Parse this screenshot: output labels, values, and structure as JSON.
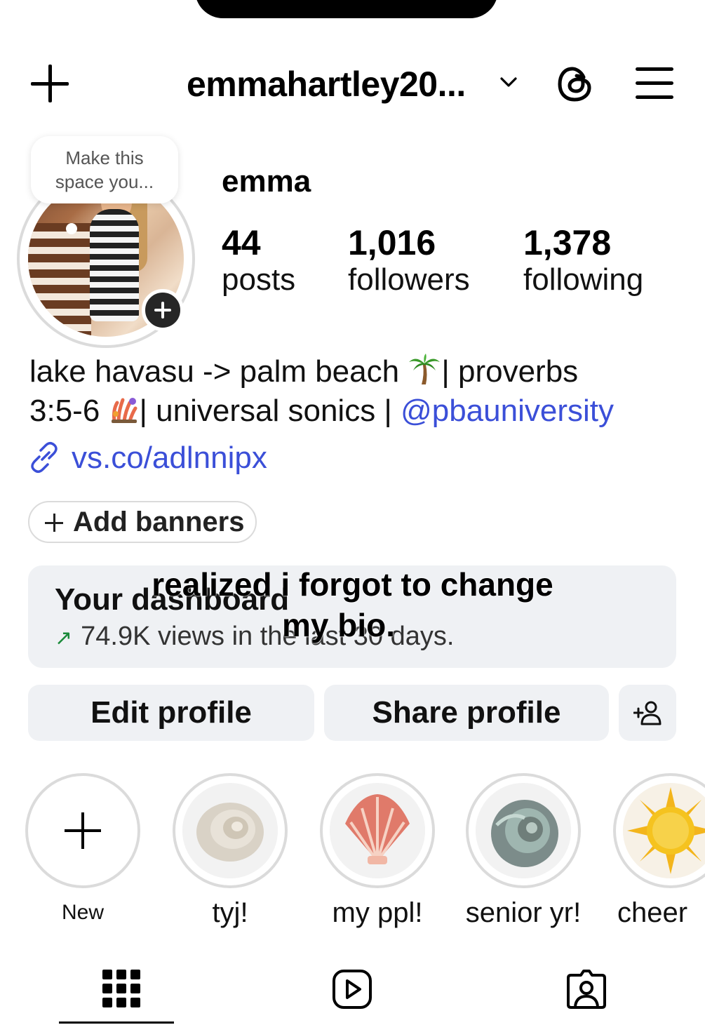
{
  "header": {
    "username": "emmahartley20...",
    "create_icon": "plus-icon",
    "dropdown_icon": "chevron-down-icon",
    "threads_icon": "threads-icon",
    "menu_icon": "hamburger-menu-icon"
  },
  "profile": {
    "note_text": "Make this space you...",
    "display_name": "emma",
    "stats": [
      {
        "value": "44",
        "label": "posts"
      },
      {
        "value": "1,016",
        "label": "followers"
      },
      {
        "value": "1,378",
        "label": "following"
      }
    ]
  },
  "bio": {
    "line1": "lake havasu -> palm beach ",
    "line1_after": "| proverbs",
    "line2_start": "3:5-6 ",
    "line2_after": "| universal sonics | ",
    "mention": "@pbauniversity",
    "link": "vs.co/adlnnipx"
  },
  "add_banners_label": "Add banners",
  "dashboard": {
    "title": "Your dashboard",
    "stats": "74.9K views in the last 30 days."
  },
  "overlay_caption": {
    "line1": "realized i forgot to change",
    "line2": "my bio."
  },
  "buttons": {
    "edit": "Edit profile",
    "share": "Share profile"
  },
  "highlights": [
    {
      "label": "New"
    },
    {
      "label": "tyj!"
    },
    {
      "label": "my ppl!"
    },
    {
      "label": "senior yr!"
    },
    {
      "label": "cheer"
    }
  ],
  "colors": {
    "link_blue": "#3b4fd8",
    "button_bg": "#eff1f4",
    "ring_grey": "#dbdbdb"
  }
}
